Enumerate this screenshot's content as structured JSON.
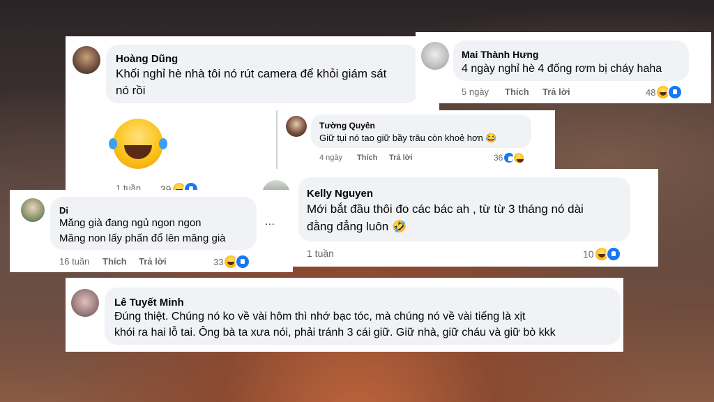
{
  "comments": {
    "hoang_dung": {
      "name": "Hoàng Dũng",
      "line1": "Khối nghỉ hè nhà tôi nó rút camera để khỏi giám sát",
      "line2": "nó rồi",
      "time": "1 tuần",
      "reactions": "39"
    },
    "mai_thanh_hung": {
      "name": "Mai Thành Hưng",
      "text": "4 ngày nghỉ hè 4 đống rơm bị cháy haha",
      "time": "5 ngày",
      "like": "Thích",
      "reply": "Trả lời",
      "reactions": "48"
    },
    "tuong_quyen": {
      "name": "Tường Quyên",
      "text": "Giữ tụi nó tao giữ bầy trâu còn khoẻ hơn 😂",
      "time": "4 ngày",
      "like": "Thích",
      "reply": "Trả lời",
      "reactions": "36"
    },
    "kelly_nguyen": {
      "name": "Kelly Nguyen",
      "line1": "Mới bắt đầu thôi đo các bác ah , từ từ 3 tháng nó dài",
      "line2": "đằng đẳng luôn 🤣",
      "time": "1 tuần",
      "reactions": "10"
    },
    "di": {
      "name": "Di",
      "line1": "Măng già đang ngủ ngon ngon",
      "line2": "Măng non lấy phấn đổ lên măng già",
      "time": "16 tuần",
      "like": "Thích",
      "reply": "Trả lời",
      "reactions": "33",
      "more": "···"
    },
    "le_tuyet_minh": {
      "name": "Lê Tuyết Minh",
      "line1": "Đúng thiệt. Chúng nó ko về vài hôm thì nhớ bạc tóc, mà chúng nó về vài tiếng là xịt",
      "line2": "khói ra hai lỗ tai. Ông bà ta xưa nói, phải tránh 3 cái giữ. Giữ nhà, giữ cháu và giữ bò kkk"
    }
  },
  "colors": {
    "bubble": "#f0f2f5",
    "meta": "#65676b",
    "like_blue": "#1877f2",
    "haha_yellow": "#fcc21b"
  }
}
